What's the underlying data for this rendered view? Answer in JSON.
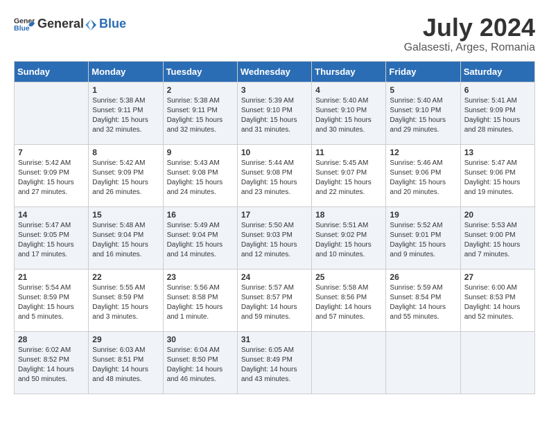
{
  "logo": {
    "text_general": "General",
    "text_blue": "Blue"
  },
  "title": "July 2024",
  "subtitle": "Galasesti, Arges, Romania",
  "days_of_week": [
    "Sunday",
    "Monday",
    "Tuesday",
    "Wednesday",
    "Thursday",
    "Friday",
    "Saturday"
  ],
  "weeks": [
    [
      {
        "day": "",
        "content": ""
      },
      {
        "day": "1",
        "content": "Sunrise: 5:38 AM\nSunset: 9:11 PM\nDaylight: 15 hours\nand 32 minutes."
      },
      {
        "day": "2",
        "content": "Sunrise: 5:38 AM\nSunset: 9:11 PM\nDaylight: 15 hours\nand 32 minutes."
      },
      {
        "day": "3",
        "content": "Sunrise: 5:39 AM\nSunset: 9:10 PM\nDaylight: 15 hours\nand 31 minutes."
      },
      {
        "day": "4",
        "content": "Sunrise: 5:40 AM\nSunset: 9:10 PM\nDaylight: 15 hours\nand 30 minutes."
      },
      {
        "day": "5",
        "content": "Sunrise: 5:40 AM\nSunset: 9:10 PM\nDaylight: 15 hours\nand 29 minutes."
      },
      {
        "day": "6",
        "content": "Sunrise: 5:41 AM\nSunset: 9:09 PM\nDaylight: 15 hours\nand 28 minutes."
      }
    ],
    [
      {
        "day": "7",
        "content": "Sunrise: 5:42 AM\nSunset: 9:09 PM\nDaylight: 15 hours\nand 27 minutes."
      },
      {
        "day": "8",
        "content": "Sunrise: 5:42 AM\nSunset: 9:09 PM\nDaylight: 15 hours\nand 26 minutes."
      },
      {
        "day": "9",
        "content": "Sunrise: 5:43 AM\nSunset: 9:08 PM\nDaylight: 15 hours\nand 24 minutes."
      },
      {
        "day": "10",
        "content": "Sunrise: 5:44 AM\nSunset: 9:08 PM\nDaylight: 15 hours\nand 23 minutes."
      },
      {
        "day": "11",
        "content": "Sunrise: 5:45 AM\nSunset: 9:07 PM\nDaylight: 15 hours\nand 22 minutes."
      },
      {
        "day": "12",
        "content": "Sunrise: 5:46 AM\nSunset: 9:06 PM\nDaylight: 15 hours\nand 20 minutes."
      },
      {
        "day": "13",
        "content": "Sunrise: 5:47 AM\nSunset: 9:06 PM\nDaylight: 15 hours\nand 19 minutes."
      }
    ],
    [
      {
        "day": "14",
        "content": "Sunrise: 5:47 AM\nSunset: 9:05 PM\nDaylight: 15 hours\nand 17 minutes."
      },
      {
        "day": "15",
        "content": "Sunrise: 5:48 AM\nSunset: 9:04 PM\nDaylight: 15 hours\nand 16 minutes."
      },
      {
        "day": "16",
        "content": "Sunrise: 5:49 AM\nSunset: 9:04 PM\nDaylight: 15 hours\nand 14 minutes."
      },
      {
        "day": "17",
        "content": "Sunrise: 5:50 AM\nSunset: 9:03 PM\nDaylight: 15 hours\nand 12 minutes."
      },
      {
        "day": "18",
        "content": "Sunrise: 5:51 AM\nSunset: 9:02 PM\nDaylight: 15 hours\nand 10 minutes."
      },
      {
        "day": "19",
        "content": "Sunrise: 5:52 AM\nSunset: 9:01 PM\nDaylight: 15 hours\nand 9 minutes."
      },
      {
        "day": "20",
        "content": "Sunrise: 5:53 AM\nSunset: 9:00 PM\nDaylight: 15 hours\nand 7 minutes."
      }
    ],
    [
      {
        "day": "21",
        "content": "Sunrise: 5:54 AM\nSunset: 8:59 PM\nDaylight: 15 hours\nand 5 minutes."
      },
      {
        "day": "22",
        "content": "Sunrise: 5:55 AM\nSunset: 8:59 PM\nDaylight: 15 hours\nand 3 minutes."
      },
      {
        "day": "23",
        "content": "Sunrise: 5:56 AM\nSunset: 8:58 PM\nDaylight: 15 hours\nand 1 minute."
      },
      {
        "day": "24",
        "content": "Sunrise: 5:57 AM\nSunset: 8:57 PM\nDaylight: 14 hours\nand 59 minutes."
      },
      {
        "day": "25",
        "content": "Sunrise: 5:58 AM\nSunset: 8:56 PM\nDaylight: 14 hours\nand 57 minutes."
      },
      {
        "day": "26",
        "content": "Sunrise: 5:59 AM\nSunset: 8:54 PM\nDaylight: 14 hours\nand 55 minutes."
      },
      {
        "day": "27",
        "content": "Sunrise: 6:00 AM\nSunset: 8:53 PM\nDaylight: 14 hours\nand 52 minutes."
      }
    ],
    [
      {
        "day": "28",
        "content": "Sunrise: 6:02 AM\nSunset: 8:52 PM\nDaylight: 14 hours\nand 50 minutes."
      },
      {
        "day": "29",
        "content": "Sunrise: 6:03 AM\nSunset: 8:51 PM\nDaylight: 14 hours\nand 48 minutes."
      },
      {
        "day": "30",
        "content": "Sunrise: 6:04 AM\nSunset: 8:50 PM\nDaylight: 14 hours\nand 46 minutes."
      },
      {
        "day": "31",
        "content": "Sunrise: 6:05 AM\nSunset: 8:49 PM\nDaylight: 14 hours\nand 43 minutes."
      },
      {
        "day": "",
        "content": ""
      },
      {
        "day": "",
        "content": ""
      },
      {
        "day": "",
        "content": ""
      }
    ]
  ]
}
